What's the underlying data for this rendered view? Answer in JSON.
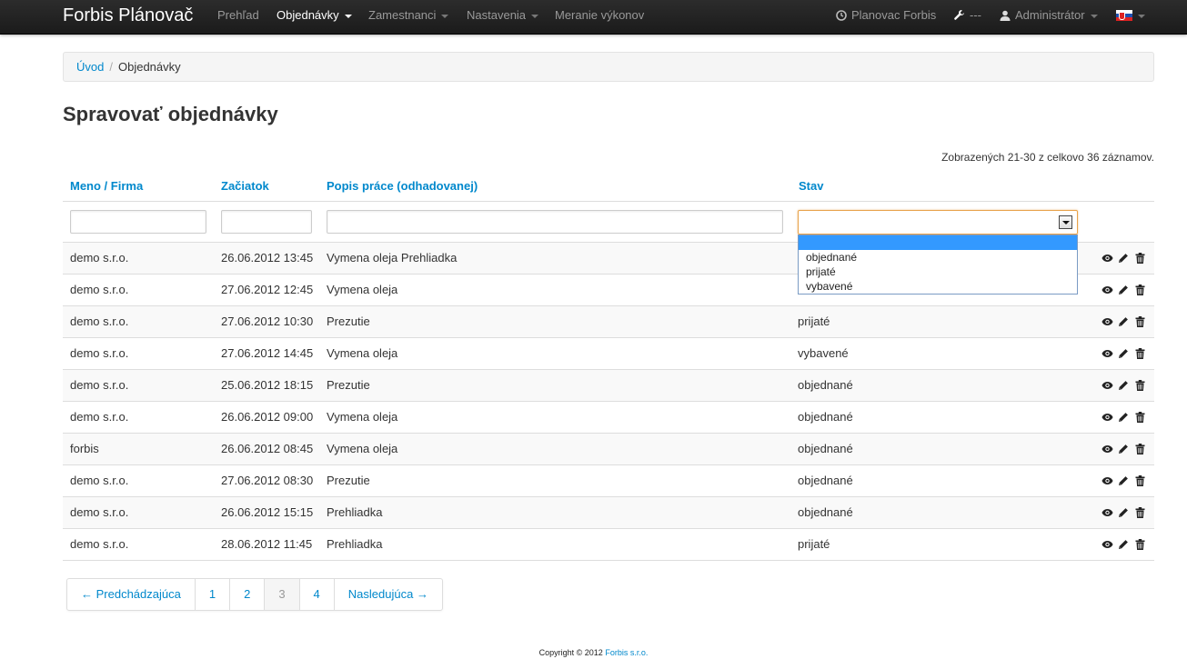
{
  "navbar": {
    "brand": "Forbis Plánovač",
    "items": [
      {
        "label": "Prehľad"
      },
      {
        "label": "Objednávky"
      },
      {
        "label": "Zamestnanci"
      },
      {
        "label": "Nastavenia"
      },
      {
        "label": "Meranie výkonov"
      }
    ],
    "right": {
      "planner": "Planovac Forbis",
      "tools": "---",
      "user": "Administrátor"
    }
  },
  "breadcrumb": {
    "home": "Úvod",
    "sep": "/",
    "current": "Objednávky"
  },
  "page": {
    "title": "Spravovať objednávky",
    "summary": "Zobrazených 21-30 z celkovo 36 záznamov."
  },
  "table": {
    "headers": [
      "Meno / Firma",
      "Začiatok",
      "Popis práce (odhadovanej)",
      "Stav"
    ],
    "rows": [
      {
        "name": "demo s.r.o.",
        "start": "26.06.2012 13:45",
        "desc": "Vymena oleja Prehliadka",
        "status": ""
      },
      {
        "name": "demo s.r.o.",
        "start": "27.06.2012 12:45",
        "desc": "Vymena oleja",
        "status": ""
      },
      {
        "name": "demo s.r.o.",
        "start": "27.06.2012 10:30",
        "desc": "Prezutie",
        "status": "prijaté"
      },
      {
        "name": "demo s.r.o.",
        "start": "27.06.2012 14:45",
        "desc": "Vymena oleja",
        "status": "vybavené"
      },
      {
        "name": "demo s.r.o.",
        "start": "25.06.2012 18:15",
        "desc": "Prezutie",
        "status": "objednané"
      },
      {
        "name": "demo s.r.o.",
        "start": "26.06.2012 09:00",
        "desc": "Vymena oleja",
        "status": "objednané"
      },
      {
        "name": "forbis",
        "start": "26.06.2012 08:45",
        "desc": "Vymena oleja",
        "status": "objednané"
      },
      {
        "name": "demo s.r.o.",
        "start": "27.06.2012 08:30",
        "desc": "Prezutie",
        "status": "objednané"
      },
      {
        "name": "demo s.r.o.",
        "start": "26.06.2012 15:15",
        "desc": "Prehliadka",
        "status": "objednané"
      },
      {
        "name": "demo s.r.o.",
        "start": "28.06.2012 11:45",
        "desc": "Prehliadka",
        "status": "prijaté"
      }
    ]
  },
  "status_filter": {
    "value": "",
    "options": [
      "",
      "objednané",
      "prijaté",
      "vybavené"
    ]
  },
  "pagination": {
    "prev": "← Predchádzajúca",
    "pages": [
      "1",
      "2",
      "3",
      "4"
    ],
    "next": "Nasledujúca →"
  },
  "footer": {
    "text": "Copyright © 2012",
    "link": "Forbis s.r.o."
  },
  "colors": {
    "link": "#0088cc",
    "navbar": "#1b1b1b",
    "dropdown_highlight": "#3399ff"
  }
}
